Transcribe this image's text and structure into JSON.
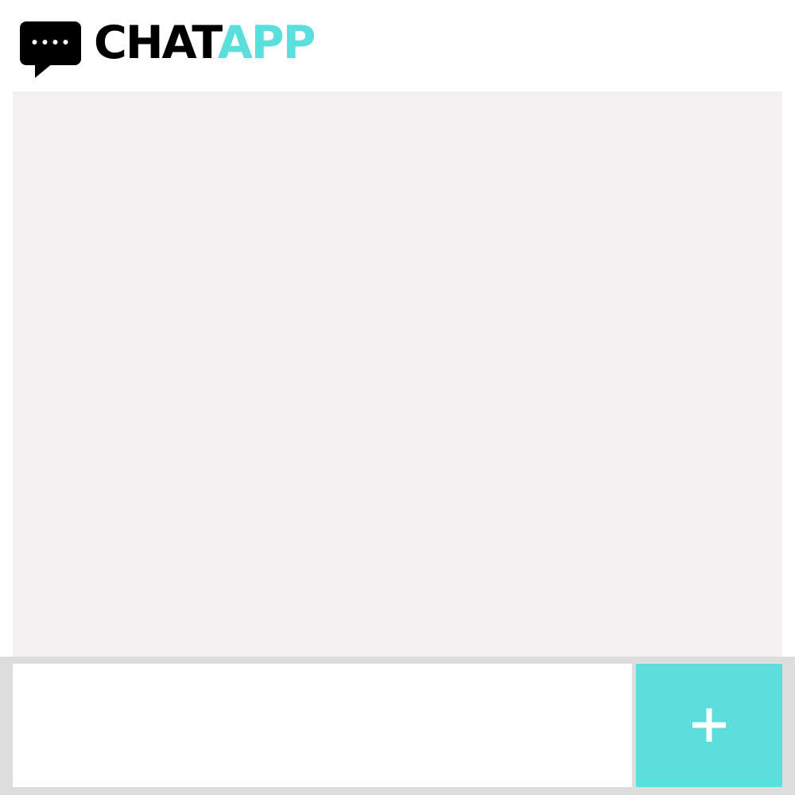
{
  "header": {
    "logo_icon": "chat-bubble-icon",
    "logo_word_a": "CHAT",
    "logo_word_b": "APP"
  },
  "composer": {
    "input_value": "",
    "input_placeholder": "",
    "add_button_icon": "plus-icon"
  },
  "colors": {
    "accent": "#5cdedc",
    "messages_background": "#f2f0f1",
    "composer_background": "#dddddd",
    "text_dark": "#000000"
  }
}
